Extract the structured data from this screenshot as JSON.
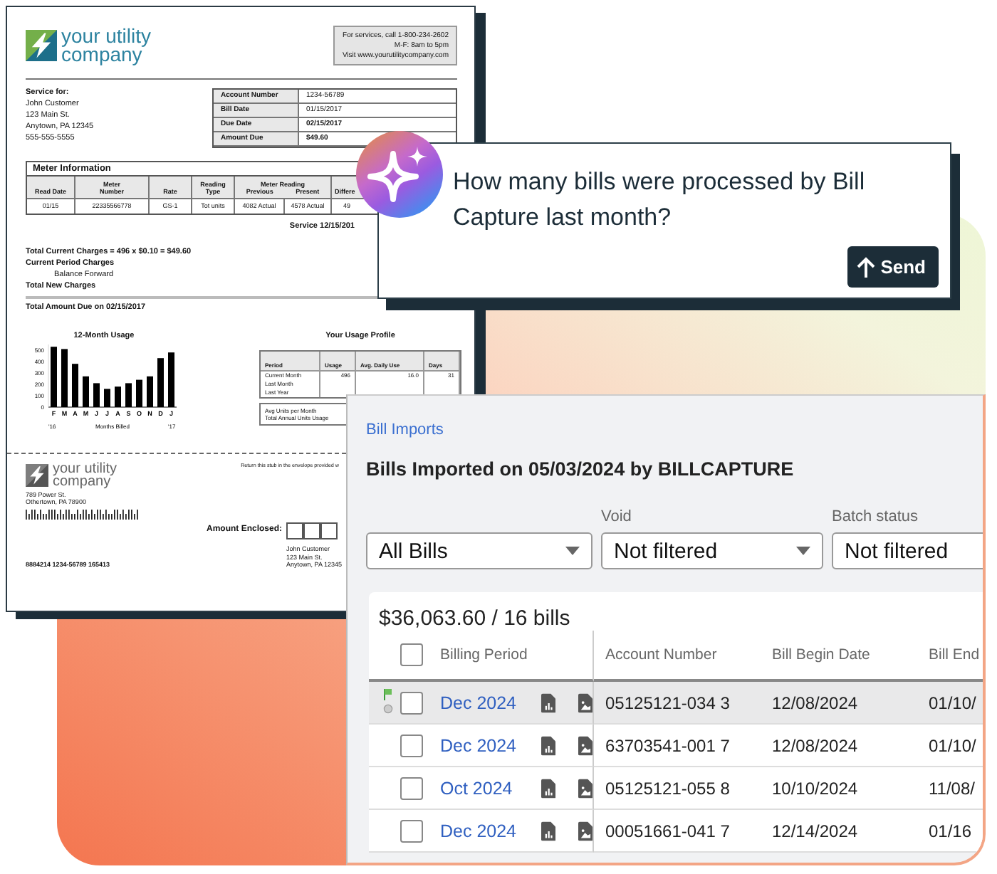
{
  "bill": {
    "logo_text": [
      "your utility",
      "company"
    ],
    "contact_lines": [
      "For services, call 1-800-234-2602",
      "M-F: 8am to 5pm",
      "Visit www.yourutilitycompany.com"
    ],
    "service_for": {
      "label": "Service for:",
      "lines": [
        "John Customer",
        "123 Main St.",
        "Anytown, PA 12345",
        "555-555-5555"
      ]
    },
    "account": [
      {
        "label": "Account Number",
        "value": "1234-56789"
      },
      {
        "label": "Bill Date",
        "value": "01/15/2017"
      },
      {
        "label": "Due Date",
        "value": "02/15/2017"
      },
      {
        "label": "Amount Due",
        "value": "$49.60"
      }
    ],
    "meter": {
      "title": "Meter Information",
      "group_label": "Meter Reading",
      "columns": [
        "Read Date",
        "Meter Number",
        "Rate",
        "Reading Type",
        "Previous",
        "Present",
        "Differe"
      ],
      "row": [
        "01/15",
        "22335566778",
        "GS-1",
        "Tot units",
        "4082 Actual",
        "4578 Actual",
        "49"
      ]
    },
    "service_line": "Service 12/15/201",
    "charges": [
      {
        "text": "Total Current Charges = 496 x $0.10 = $49.60",
        "kind": "bold"
      },
      {
        "text": "Current Period Charges",
        "kind": "bold"
      },
      {
        "text": "Balance Forward",
        "kind": "indent"
      },
      {
        "text": "Total New Charges",
        "kind": "bold"
      },
      {
        "text": "Total Amount Due on 02/15/2017",
        "kind": "total"
      }
    ],
    "usage_chart": {
      "title": "12-Month Usage",
      "year_labels": [
        "'16",
        "'17"
      ],
      "chart_data": {
        "type": "bar",
        "xlabel": "Months Billed",
        "categories": [
          "F",
          "M",
          "A",
          "M",
          "J",
          "J",
          "A",
          "S",
          "O",
          "N",
          "D",
          "J"
        ],
        "values": [
          530,
          510,
          380,
          270,
          210,
          160,
          180,
          210,
          240,
          270,
          430,
          480
        ],
        "ylim": [
          0,
          550
        ],
        "yticks": [
          0,
          100,
          200,
          300,
          400,
          500
        ]
      }
    },
    "usage_profile": {
      "title": "Your Usage Profile",
      "columns": [
        "Period",
        "Usage",
        "Avg. Daily Use",
        "Days"
      ],
      "rows": [
        {
          "period": "Current Month",
          "values": [
            "496",
            "16.0",
            "31"
          ]
        },
        {
          "period": "Last Month"
        },
        {
          "period": "Last Year"
        }
      ],
      "summary": [
        "Avg Units per Month",
        "Total Annual Units Usage"
      ]
    },
    "stub": {
      "logo_text": [
        "your utility",
        "company"
      ],
      "address": [
        "789 Power St.",
        "Othertown, PA 78900"
      ],
      "return_note": "Return this stub in the envelope provided w",
      "amount_label": "Amount Enclosed:",
      "customer": [
        "John Customer",
        "123 Main St.",
        "Anytown, PA 12345"
      ],
      "scanline": "8884214 1234-56789 165413"
    }
  },
  "chat": {
    "question": "How many bills were processed by Bill Capture last month?",
    "send_label": "Send"
  },
  "imports": {
    "breadcrumb": "Bill Imports",
    "title": "Bills Imported on 05/03/2024 by BILLCAPTURE",
    "filters": [
      {
        "value": "All Bills"
      },
      {
        "label": "Void",
        "value": "Not filtered"
      },
      {
        "label": "Batch status",
        "value": "Not filtered"
      }
    ],
    "summary": "$36,063.60 / 16 bills",
    "header_checked": false,
    "columns": [
      "Billing Period",
      "Account Number",
      "Bill Begin Date",
      "Bill End"
    ],
    "rows": [
      {
        "period": "Dec 2024",
        "account": "05125121-034 3",
        "begin": "12/08/2024",
        "end": "01/10/",
        "selected": true,
        "flagged": true,
        "checked": false
      },
      {
        "period": "Dec 2024",
        "account": "63703541-001 7",
        "begin": "12/08/2024",
        "end": "01/10/",
        "selected": false,
        "flagged": false,
        "checked": false
      },
      {
        "period": "Oct 2024",
        "account": "05125121-055 8",
        "begin": "10/10/2024",
        "end": "11/08/",
        "selected": false,
        "flagged": false,
        "checked": false
      },
      {
        "period": "Dec 2024",
        "account": "00051661-041 7",
        "begin": "12/14/2024",
        "end": "01/16",
        "selected": false,
        "flagged": false,
        "checked": false
      }
    ]
  }
}
